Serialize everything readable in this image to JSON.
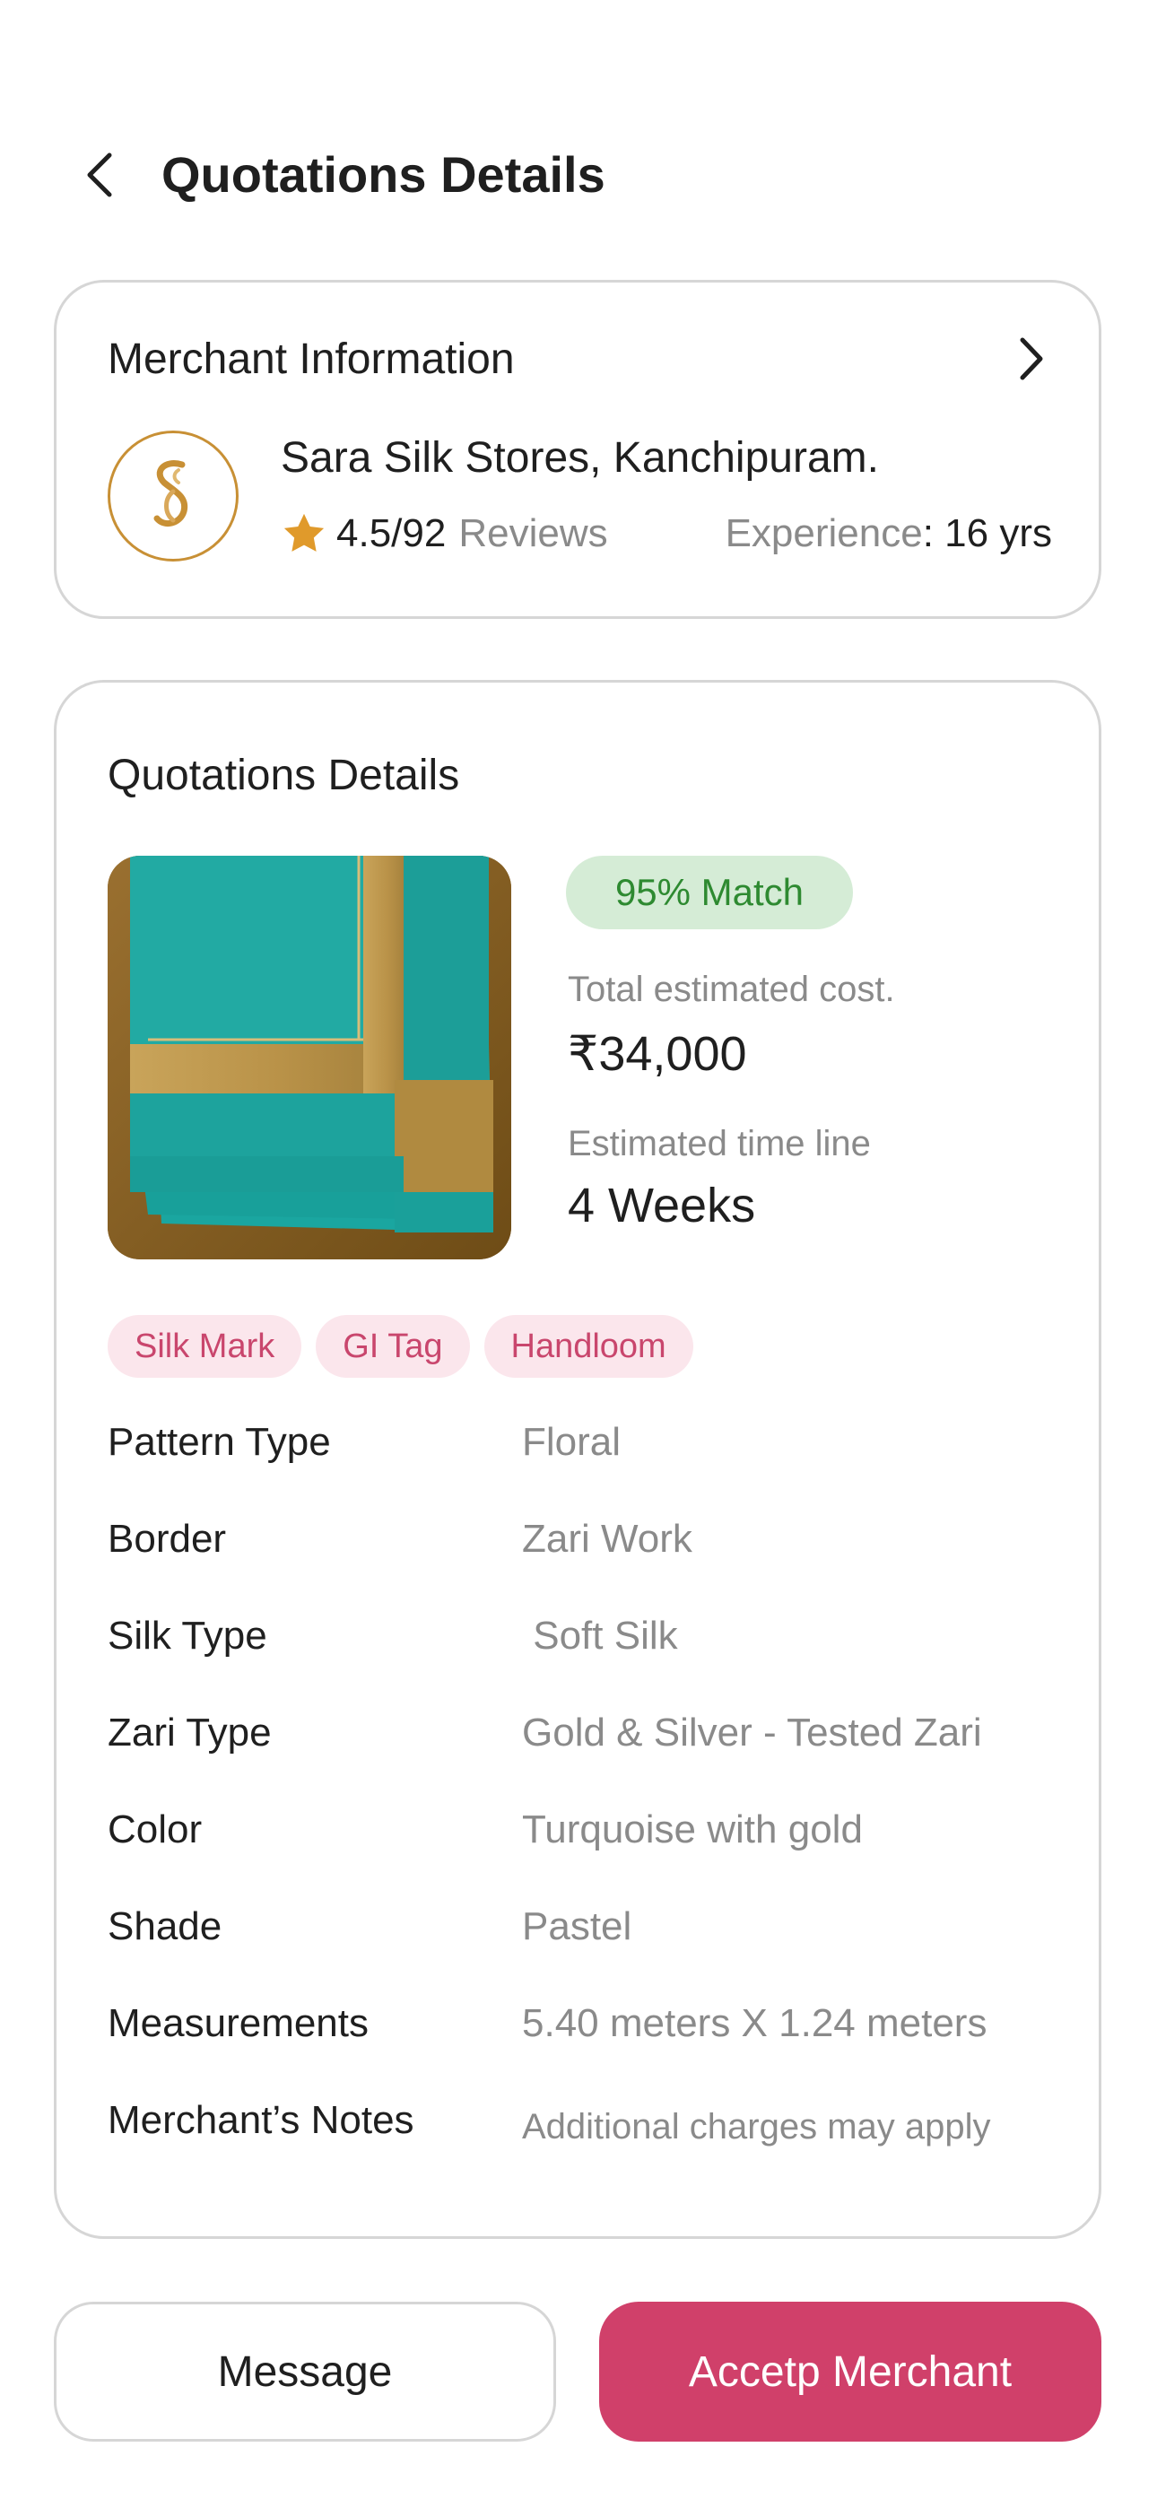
{
  "header": {
    "title": "Quotations Details",
    "back_icon": "chevron-left-icon"
  },
  "merchant": {
    "section_title": "Merchant Information",
    "name": "Sara Silk Stores, Kanchipuram.",
    "rating": "4.5/92",
    "reviews_label": "Reviews",
    "experience_label": "Experience",
    "experience_colon": ":",
    "experience_value": "16 yrs",
    "logo_icon": "merchant-logo",
    "arrow_icon": "chevron-right-icon",
    "star_color": "#e09a2b",
    "logo_color": "#c89035"
  },
  "quotation": {
    "section_title": "Quotations Details",
    "match_badge": "95% Match",
    "cost_label": "Total estimated cost.",
    "cost_value": "₹34,000",
    "time_label": "Estimated time line",
    "time_value": "4 Weeks",
    "tags": [
      "Silk Mark",
      "GI Tag",
      "Handloom"
    ],
    "specs": [
      {
        "key": "Pattern Type",
        "value": "Floral"
      },
      {
        "key": "Border",
        "value": "Zari Work"
      },
      {
        "key": "Silk Type",
        "value": " Soft Silk"
      },
      {
        "key": "Zari Type",
        "value": "Gold & Silver - Tested Zari"
      },
      {
        "key": "Color",
        "value": "Turquoise with gold"
      },
      {
        "key": "Shade",
        "value": "Pastel"
      },
      {
        "key": "Measurements",
        "value": "5.40 meters X 1.24 meters"
      },
      {
        "key": "Merchant’s Notes",
        "value": "Additional charges may apply"
      }
    ]
  },
  "actions": {
    "message_label": "Message",
    "accept_label": "Accetp Merchant",
    "accent_color": "#d0406a"
  }
}
